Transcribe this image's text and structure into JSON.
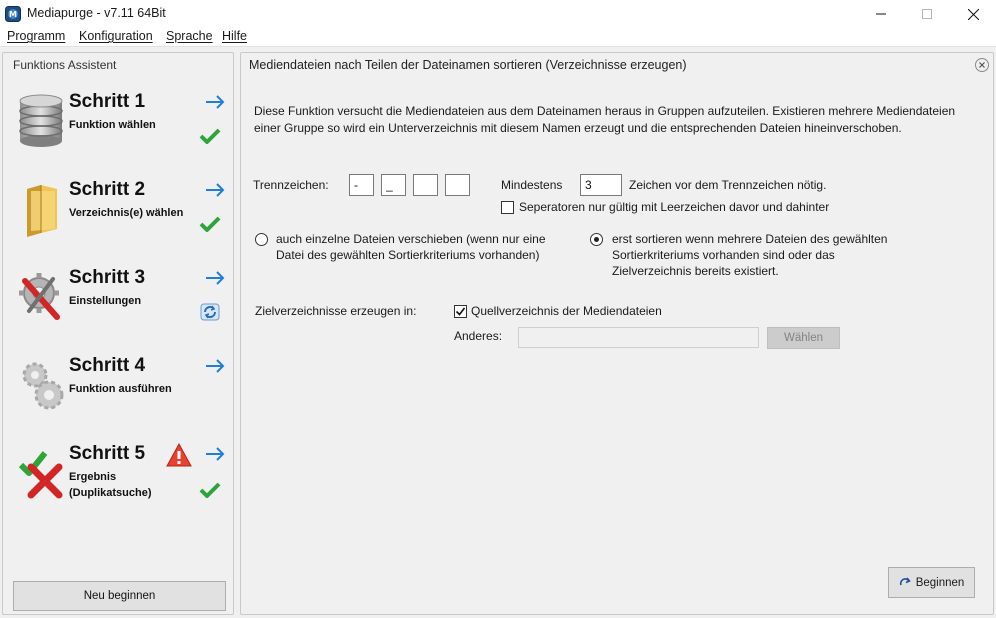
{
  "window": {
    "title": "Mediapurge - v7.11 64Bit",
    "controls": [
      "minimize",
      "maximize",
      "close"
    ]
  },
  "menu": [
    "Programm",
    "Konfiguration",
    "Sprache",
    "Hilfe"
  ],
  "wizard": {
    "heading": "Funktions Assistent",
    "steps": [
      {
        "title": "Schritt 1",
        "subtitle": "Funktion wählen",
        "icon": "database-icon",
        "status": "check-icon"
      },
      {
        "title": "Schritt 2",
        "subtitle": "Verzeichnis(e) wählen",
        "icon": "folder-icon",
        "status": "check-icon"
      },
      {
        "title": "Schritt 3",
        "subtitle": "Einstellungen",
        "icon": "settings-tools-icon",
        "status": "refresh-icon"
      },
      {
        "title": "Schritt 4",
        "subtitle": "Funktion ausführen",
        "icon": "gears-icon",
        "status": ""
      },
      {
        "title": "Schritt 5",
        "subtitle": "Ergebnis",
        "subtitle2": "(Duplikatsuche)",
        "icon": "result-icon",
        "status": "check-icon",
        "warning": "warning-icon"
      }
    ],
    "restart_button": "Neu beginnen"
  },
  "main": {
    "title": "Mediendateien nach Teilen der Dateinamen sortieren (Verzeichnisse erzeugen)",
    "description": "Diese Funktion versucht die Mediendateien aus dem Dateinamen heraus in Gruppen aufzuteilen. Existieren mehrere Mediendateien einer Gruppe so wird ein Unterverzeichnis mit diesem Namen erzeugt und die entsprechenden Dateien hineinverschoben.",
    "separator_label": "Trennzeichen:",
    "separators": [
      "-",
      "_",
      "",
      ""
    ],
    "min_label": "Mindestens",
    "min_value": "3",
    "min_suffix": "Zeichen vor dem Trennzeichen nötig.",
    "spaces_checkbox": {
      "label": "Seperatoren nur gültig mit Leerzeichen davor und dahinter",
      "checked": false
    },
    "radio_single": {
      "line1": "auch einzelne Dateien verschieben (wenn nur eine",
      "line2": "Datei des gewählten Sortierkriteriums vorhanden)",
      "selected": false
    },
    "radio_multi": {
      "line1": "erst sortieren wenn mehrere Dateien des gewählten",
      "line2": "Sortierkriteriums vorhanden sind oder das",
      "line3": "Zielverzeichnis bereits existiert.",
      "selected": true
    },
    "target_label": "Zielverzeichnisse erzeugen in:",
    "source_checkbox": {
      "label": "Quellverzeichnis der Mediendateien",
      "checked": true
    },
    "other_label": "Anderes:",
    "other_value": "",
    "choose_button": "Wählen",
    "begin_button": "Beginnen"
  },
  "colors": {
    "arrow": "#1e7ed8",
    "check": "#2ea43a",
    "warning": "#d42b1e",
    "panel_bg": "#f0f0f0"
  }
}
